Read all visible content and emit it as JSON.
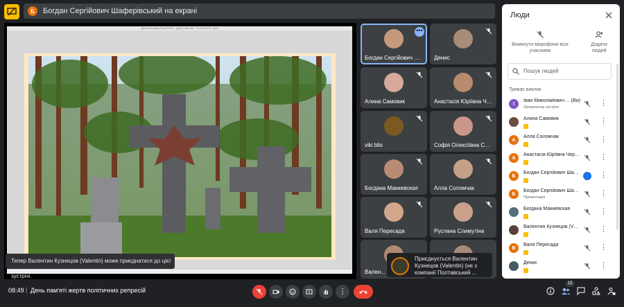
{
  "banner": {
    "avatar_letter": "Б",
    "text": "Богдан Сергійович Шаферівський на екрані"
  },
  "screen": {
    "window_title": "Демонстрація PowerPoint - [День пам'яті] - PowerPoint - pptx"
  },
  "toast": "Тепер Валентин Кузнецов (Valentin) може приєднатися до цієї зустрічі.",
  "tiles": [
    {
      "name": "Богдан Сергійович Ша..."
    },
    {
      "name": "Денис"
    },
    {
      "name": "Алина Самовик"
    },
    {
      "name": "Анастасія Юріївна Чер..."
    },
    {
      "name": "viki blis"
    },
    {
      "name": "Софія Олексіївна Степан..."
    },
    {
      "name": "Богдана Макиевская"
    },
    {
      "name": "Алла Соломчак"
    },
    {
      "name": "Валя Пересада"
    },
    {
      "name": "Руслана Слимутіна"
    },
    {
      "name": "Вален..."
    },
    {
      "name": ""
    }
  ],
  "join_popup": "Приєднується Валентин Кузнецов (Valentin) (не з компанії Полтавський ...",
  "panel": {
    "title": "Люди",
    "mute_all": "Вимкнути мікрофони всіх учасників",
    "add_people": "Додати людей",
    "search_placeholder": "Пошук людей",
    "call_label": "Триває виклик",
    "people": [
      {
        "letter": "І",
        "name": "Іван Миколайович ... (Ви)",
        "sub": "Організатор зустрічі",
        "color": "#7e57c2"
      },
      {
        "letter": "",
        "name": "Алина Самовик",
        "sub": "",
        "color": "#6d4c41"
      },
      {
        "letter": "А",
        "name": "Алла Соломчак",
        "sub": "",
        "color": "#e8710a"
      },
      {
        "letter": "А",
        "name": "Анастасія Юріївна Черн...",
        "sub": "",
        "color": "#e8710a"
      },
      {
        "letter": "Б",
        "name": "Богдан Сергійович Шаф...",
        "sub": "",
        "color": "#e8710a"
      },
      {
        "letter": "Б",
        "name": "Богдан Сергійович Шаф...",
        "sub": "Презентація",
        "color": "#e8710a"
      },
      {
        "letter": "",
        "name": "Богдана Макиевская",
        "sub": "",
        "color": "#546e7a"
      },
      {
        "letter": "",
        "name": "Валентин Кузнецов (Valen...",
        "sub": "",
        "color": "#5d4037"
      },
      {
        "letter": "В",
        "name": "Валя Пересада",
        "sub": "",
        "color": "#e8710a"
      },
      {
        "letter": "",
        "name": "Денис",
        "sub": "",
        "color": "#455a64"
      }
    ]
  },
  "bottom": {
    "time": "08:49",
    "separator": "|",
    "meeting_name": "День пам'яті жертв політичних репресій",
    "people_count": "13"
  },
  "colors": {
    "accent": "#8ab4f8",
    "danger": "#ea4335",
    "orange_avatar": "#e8710a",
    "background": "#202124"
  }
}
